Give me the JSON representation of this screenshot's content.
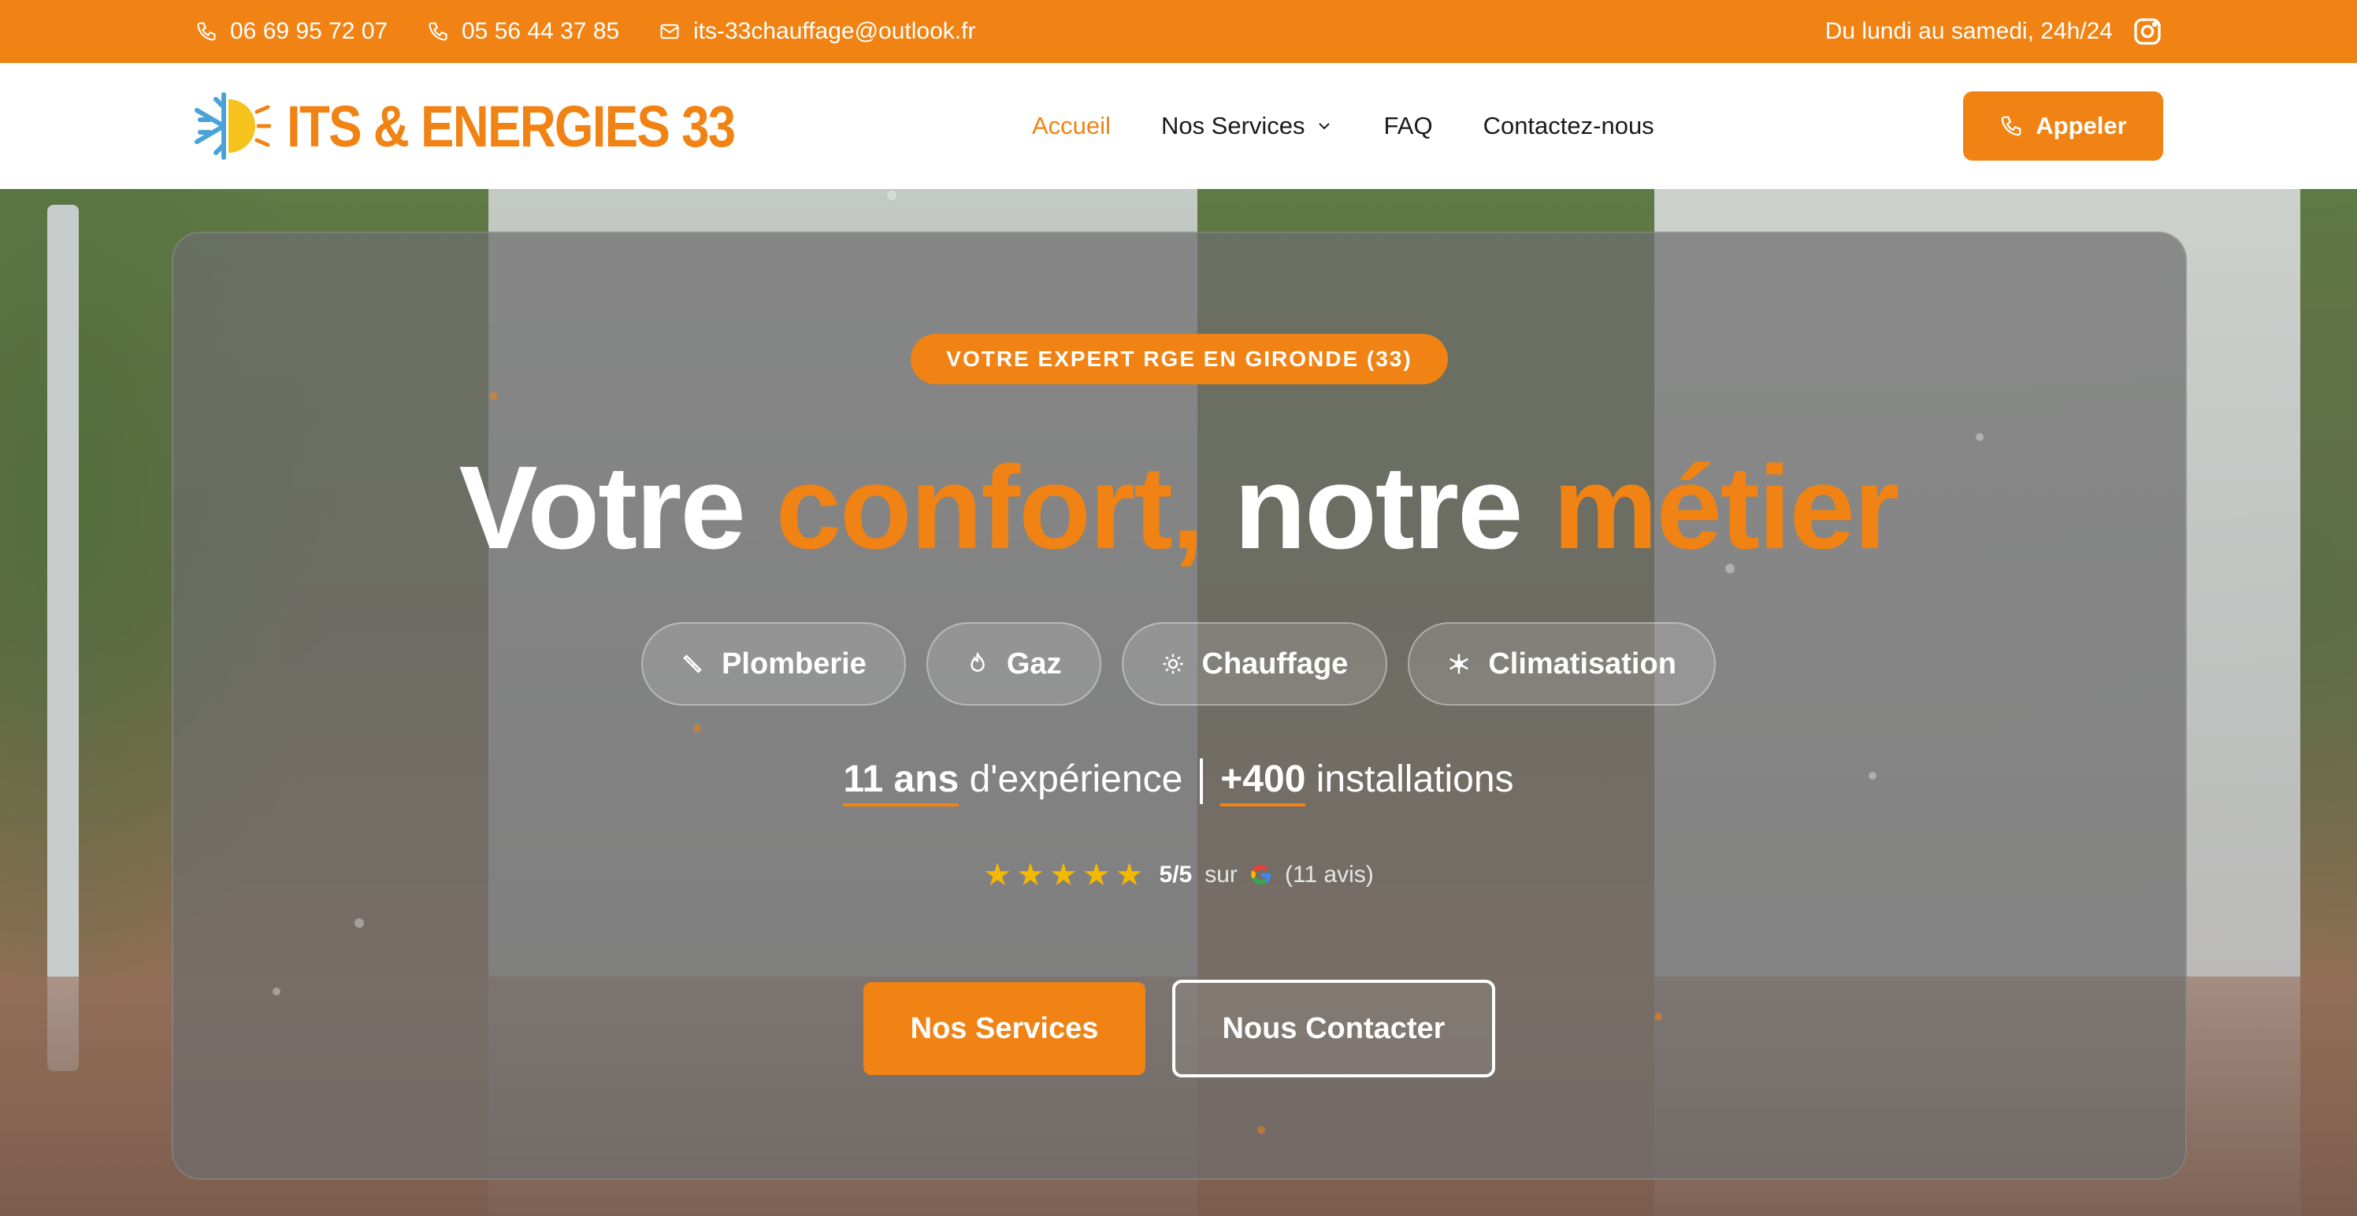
{
  "topbar": {
    "phone1": "06 69 95 72 07",
    "phone2": "05 56 44 37 85",
    "email": "its-33chauffage@outlook.fr",
    "hours": "Du lundi au samedi, 24h/24"
  },
  "header": {
    "logo_text": "ITS & ENERGIES 33",
    "nav": {
      "home": "Accueil",
      "services": "Nos Services",
      "faq": "FAQ",
      "contact": "Contactez-nous"
    },
    "call_button": "Appeler"
  },
  "hero": {
    "badge": "VOTRE EXPERT RGE EN GIRONDE (33)",
    "headline": {
      "part1": "Votre ",
      "accent1": "confort,",
      "part2": " notre ",
      "accent2": "métier"
    },
    "pills": {
      "plumbing": "Plomberie",
      "gas": "Gaz",
      "heating": "Chauffage",
      "ac": "Climatisation"
    },
    "stats": {
      "years_value": "11 ans",
      "years_label": " d'expérience",
      "installs_value": "+400",
      "installs_label": " installations"
    },
    "rating": {
      "stars": "★★★★★",
      "score": "5/5",
      "on": "sur",
      "reviews": "(11 avis)"
    },
    "buttons": {
      "services": "Nos Services",
      "contact": "Nous Contacter"
    }
  },
  "colors": {
    "accent": "#f08314",
    "star": "#f5b800"
  },
  "icons": [
    "phone-icon",
    "mail-icon",
    "instagram-icon",
    "chevron-down-icon",
    "wrench-icon",
    "flame-icon",
    "sun-icon",
    "snowflake-icon",
    "google-icon"
  ]
}
